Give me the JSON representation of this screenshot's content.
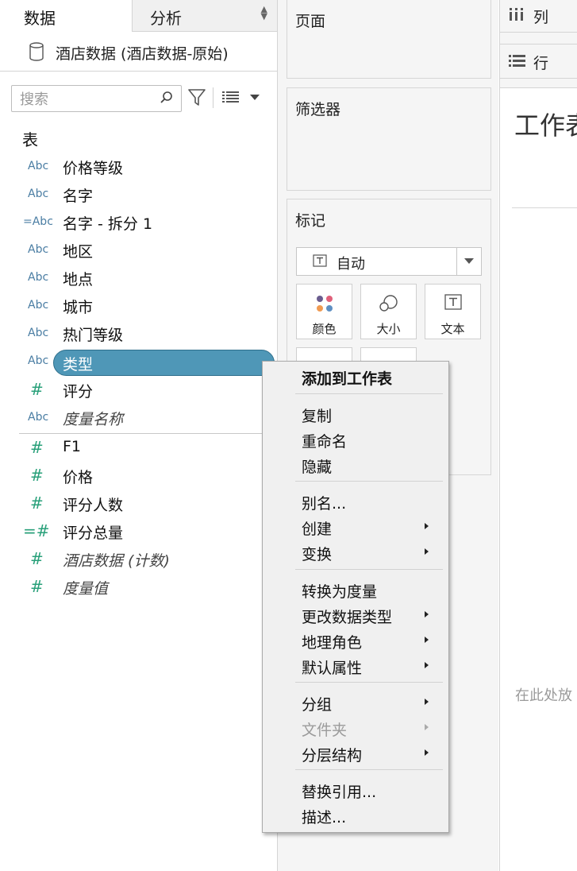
{
  "tabs": {
    "data": "数据",
    "analysis": "分析"
  },
  "datasource": {
    "label": "酒店数据 (酒店数据-原始)"
  },
  "search": {
    "placeholder": "搜索"
  },
  "tables_heading": "表",
  "dimensions": [
    {
      "type": "Abc",
      "name": "价格等级"
    },
    {
      "type": "Abc",
      "name": "名字"
    },
    {
      "type": "=Abc",
      "name": "名字 - 拆分 1"
    },
    {
      "type": "Abc",
      "name": "地区"
    },
    {
      "type": "Abc",
      "name": "地点"
    },
    {
      "type": "Abc",
      "name": "城市"
    },
    {
      "type": "Abc",
      "name": "热门等级"
    },
    {
      "type": "Abc",
      "name": "类型"
    },
    {
      "type": "#",
      "name": "评分"
    },
    {
      "type": "Abc",
      "name": "度量名称"
    }
  ],
  "measures": [
    {
      "type": "#",
      "name": "F1"
    },
    {
      "type": "#",
      "name": "价格"
    },
    {
      "type": "#",
      "name": "评分人数"
    },
    {
      "type": "=#",
      "name": "评分总量"
    },
    {
      "type": "#",
      "name": "酒店数据 (计数)"
    },
    {
      "type": "#",
      "name": "度量值"
    }
  ],
  "shelves": {
    "pages": "页面",
    "filters": "筛选器",
    "marks": "标记",
    "columns": "列",
    "rows": "行"
  },
  "marks": {
    "type": "自动",
    "color": "颜色",
    "size": "大小",
    "text": "文本"
  },
  "canvas": {
    "title": "工作表",
    "drop_hint": "在此处放"
  },
  "context_menu": {
    "add_to_sheet": "添加到工作表",
    "duplicate": "复制",
    "rename": "重命名",
    "hide": "隐藏",
    "aliases": "别名...",
    "create": "创建",
    "transform": "变换",
    "convert_to_measure": "转换为度量",
    "change_data_type": "更改数据类型",
    "geographic_role": "地理角色",
    "default_properties": "默认属性",
    "group_by": "分组",
    "folders": "文件夹",
    "hierarchy": "分层结构",
    "replace_references": "替换引用...",
    "describe": "描述..."
  },
  "colors": {
    "selected_pill": "#4f97b7",
    "dimension_icon": "#4a7da3",
    "measure_icon": "#29a07a"
  }
}
